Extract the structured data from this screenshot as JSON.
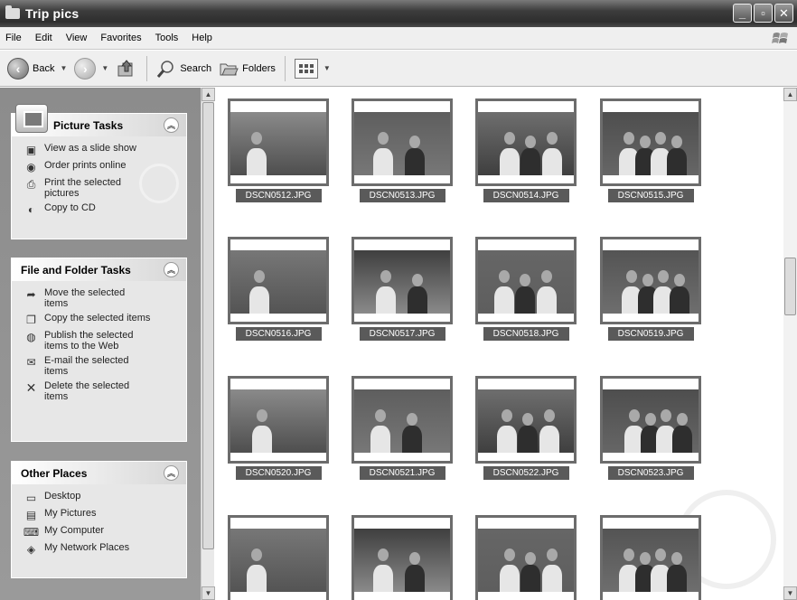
{
  "window": {
    "title": "Trip pics"
  },
  "menu": [
    "File",
    "Edit",
    "View",
    "Favorites",
    "Tools",
    "Help"
  ],
  "toolbar": {
    "back_label": "Back",
    "search_label": "Search",
    "folders_label": "Folders"
  },
  "left_pane": {
    "picture_tasks": {
      "title": "Picture Tasks",
      "items": [
        "View as a slide show",
        "Order prints online",
        "Print the selected pictures",
        "Copy to CD"
      ]
    },
    "file_folder_tasks": {
      "title": "File and Folder Tasks",
      "items": [
        "Move the selected items",
        "Copy the selected items",
        "Publish the selected items to the Web",
        "E-mail the selected items",
        "Delete the selected items"
      ]
    },
    "other_places": {
      "title": "Other Places",
      "items": [
        "Desktop",
        "My Pictures",
        "My Computer",
        "My Network Places"
      ]
    }
  },
  "files": [
    "DSCN0512.JPG",
    "DSCN0513.JPG",
    "DSCN0514.JPG",
    "DSCN0515.JPG",
    "DSCN0516.JPG",
    "DSCN0517.JPG",
    "DSCN0518.JPG",
    "DSCN0519.JPG",
    "DSCN0520.JPG",
    "DSCN0521.JPG",
    "DSCN0522.JPG",
    "DSCN0523.JPG",
    "",
    "",
    "",
    ""
  ]
}
